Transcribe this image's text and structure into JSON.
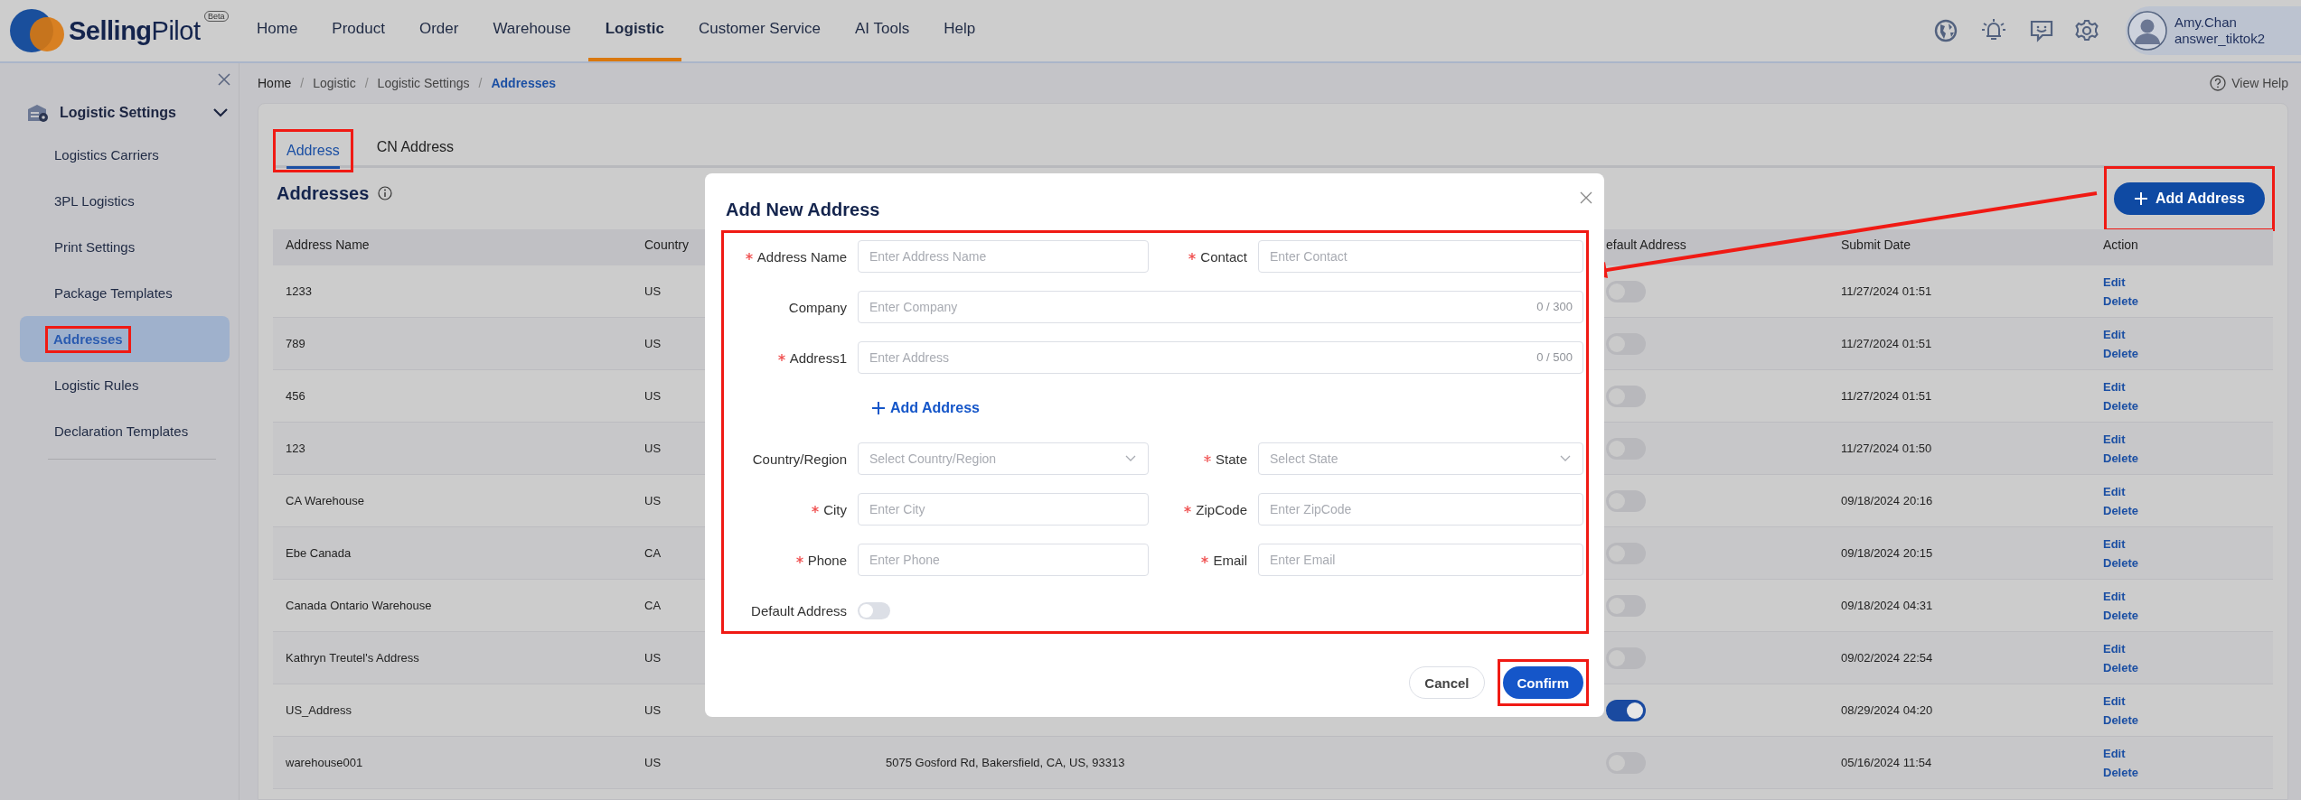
{
  "brand": {
    "name": "**Selling**Pilot",
    "badge": "Beta"
  },
  "nav": [
    {
      "label": "Home",
      "selected": false
    },
    {
      "label": "Product",
      "selected": false
    },
    {
      "label": "Order",
      "selected": false
    },
    {
      "label": "Warehouse",
      "selected": false
    },
    {
      "label": "Logistic",
      "selected": true
    },
    {
      "label": "Customer Service",
      "selected": false
    },
    {
      "label": "AI Tools",
      "selected": false
    },
    {
      "label": "Help",
      "selected": false
    }
  ],
  "user": {
    "name": "Amy.Chan",
    "account": "answer_tiktok2"
  },
  "sidebar": {
    "group": {
      "label": "Logistic Settings",
      "expanded": true
    },
    "items": [
      {
        "label": "Logistics Carriers",
        "selected": false,
        "highlighted": false
      },
      {
        "label": "3PL Logistics",
        "selected": false,
        "highlighted": false
      },
      {
        "label": "Print Settings",
        "selected": false,
        "highlighted": false
      },
      {
        "label": "Package Templates",
        "selected": false,
        "highlighted": false
      },
      {
        "label": "Addresses",
        "selected": true,
        "highlighted": true
      },
      {
        "label": "Logistic Rules",
        "selected": false,
        "highlighted": false
      },
      {
        "label": "Declaration Templates",
        "selected": false,
        "highlighted": false
      }
    ]
  },
  "breadcrumb": [
    {
      "label": "Home",
      "current": false
    },
    {
      "separator": "/",
      "label": "Logistic",
      "current": false
    },
    {
      "separator": "/",
      "label": "Logistic Settings",
      "current": false
    },
    {
      "separator": "/",
      "label": "Addresses",
      "current": true
    }
  ],
  "help_link": "View Help",
  "tabs": [
    {
      "label": "Address",
      "selected": true,
      "highlighted": true
    },
    {
      "label": "CN Address",
      "selected": false,
      "highlighted": false
    }
  ],
  "section": {
    "title": "Addresses"
  },
  "add_button": {
    "label": "Add Address",
    "highlighted": true,
    "callout_arrow": true
  },
  "table": {
    "columns": [
      "Address Name",
      "Country",
      "efault Address",
      "Submit Date",
      "Action"
    ],
    "rows": [
      {
        "name": "1233",
        "country": "US",
        "default": false,
        "date": "11/27/2024 01:51",
        "actions": [
          "Edit",
          "Delete"
        ]
      },
      {
        "name": "789",
        "country": "US",
        "default": false,
        "date": "11/27/2024 01:51",
        "actions": [
          "Edit",
          "Delete"
        ]
      },
      {
        "name": "456",
        "country": "US",
        "default": false,
        "date": "11/27/2024 01:51",
        "actions": [
          "Edit",
          "Delete"
        ]
      },
      {
        "name": "123",
        "country": "US",
        "default": false,
        "date": "11/27/2024 01:50",
        "actions": [
          "Edit",
          "Delete"
        ]
      },
      {
        "name": "CA Warehouse",
        "country": "US",
        "default": false,
        "date": "09/18/2024 20:16",
        "actions": [
          "Edit",
          "Delete"
        ]
      },
      {
        "name": "Ebe Canada",
        "country": "CA",
        "default": false,
        "date": "09/18/2024 20:15",
        "actions": [
          "Edit",
          "Delete"
        ]
      },
      {
        "name": "Canada Ontario Warehouse",
        "country": "CA",
        "default": false,
        "date": "09/18/2024 04:31",
        "actions": [
          "Edit",
          "Delete"
        ]
      },
      {
        "name": "Kathryn Treutel's Address",
        "country": "US",
        "default": false,
        "date": "09/02/2024 22:54",
        "actions": [
          "Edit",
          "Delete"
        ]
      },
      {
        "name": "US_Address",
        "country": "US",
        "default": true,
        "date": "08/29/2024 04:20",
        "actions": [
          "Edit",
          "Delete"
        ]
      },
      {
        "name": "warehouse001",
        "country": "US",
        "address": "5075 Gosford Rd, Bakersfield, CA, US, 93313",
        "default": false,
        "date": "05/16/2024 11:54",
        "actions": [
          "Edit",
          "Delete"
        ]
      }
    ]
  },
  "dialog": {
    "title": "Add New Address",
    "form_highlighted": true,
    "rows": [
      [
        {
          "kind": "input",
          "label": "Address Name",
          "required": true,
          "placeholder": "Enter Address Name"
        },
        {
          "kind": "input",
          "label": "Contact",
          "required": true,
          "placeholder": "Enter Contact"
        }
      ],
      [
        {
          "kind": "input",
          "label": "Company",
          "required": false,
          "placeholder": "Enter Company",
          "counter": "0 / 300"
        }
      ],
      [
        {
          "kind": "input",
          "label": "Address1",
          "required": true,
          "placeholder": "Enter Address",
          "counter": "0 / 500"
        }
      ],
      [
        {
          "kind": "link",
          "label": "Add Address"
        }
      ],
      [
        {
          "kind": "select",
          "label": "Country/Region",
          "required": false,
          "placeholder": "Select Country/Region"
        },
        {
          "kind": "select",
          "label": "State",
          "required": true,
          "placeholder": "Select State"
        }
      ],
      [
        {
          "kind": "input",
          "label": "City",
          "required": true,
          "placeholder": "Enter City"
        },
        {
          "kind": "input",
          "label": "ZipCode",
          "required": true,
          "placeholder": "Enter ZipCode"
        }
      ],
      [
        {
          "kind": "input",
          "label": "Phone",
          "required": true,
          "placeholder": "Enter Phone"
        },
        {
          "kind": "input",
          "label": "Email",
          "required": true,
          "placeholder": "Enter Email"
        }
      ],
      [
        {
          "kind": "toggle",
          "label": "Default Address",
          "on": false
        }
      ]
    ],
    "buttons": [
      {
        "label": "Cancel",
        "kind": "secondary",
        "highlighted": false
      },
      {
        "label": "Confirm",
        "kind": "primary",
        "highlighted": true
      }
    ]
  }
}
